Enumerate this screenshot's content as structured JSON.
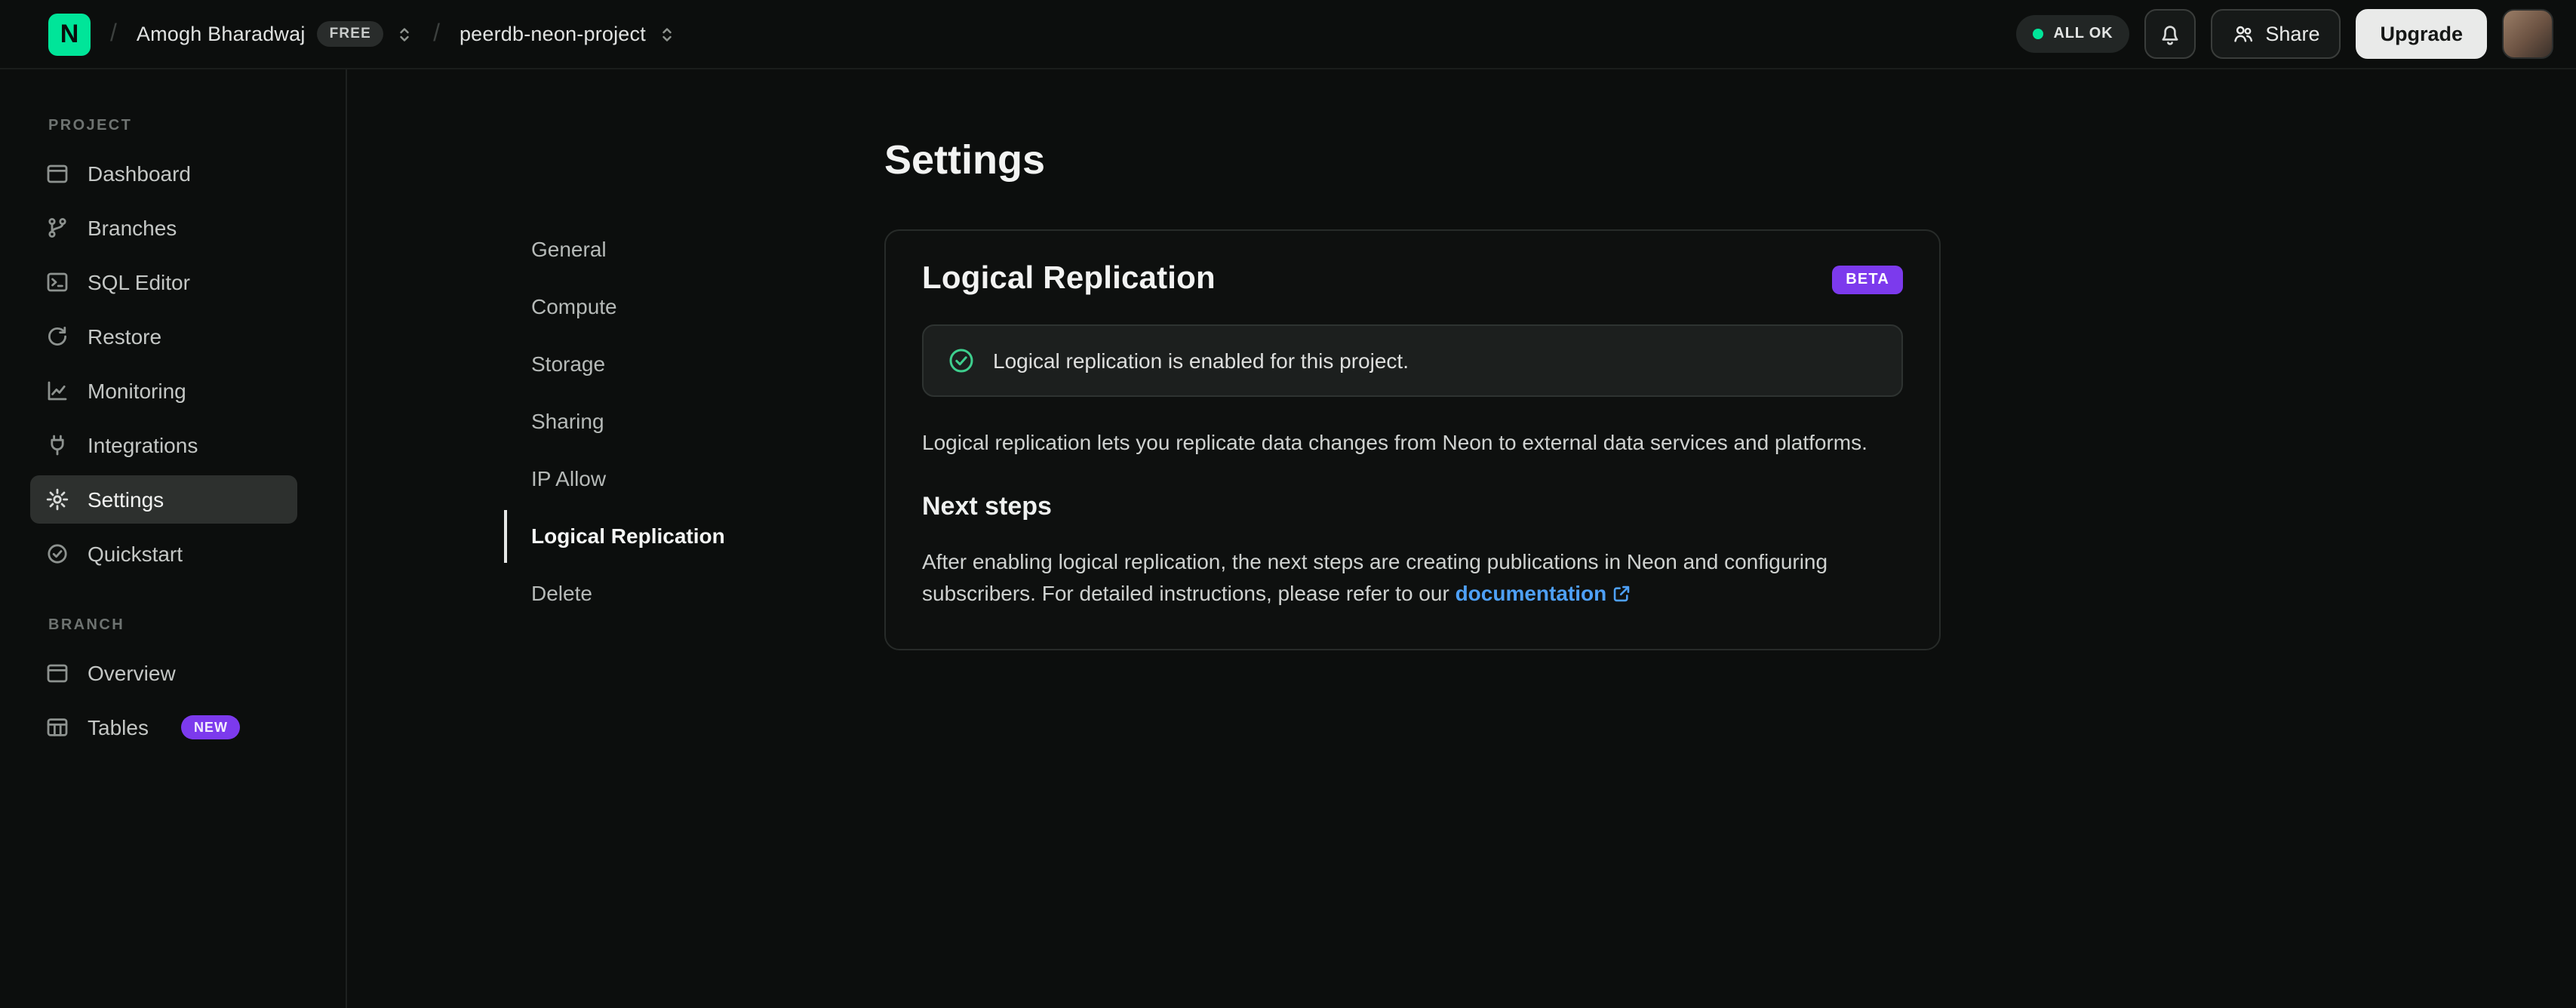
{
  "header": {
    "logo_letter": "N",
    "breadcrumb": {
      "separator": "/",
      "org_name": "Amogh Bharadwaj",
      "org_plan_badge": "FREE",
      "project_name": "peerdb-neon-project"
    },
    "status_label": "ALL OK",
    "share_label": "Share",
    "upgrade_label": "Upgrade"
  },
  "sidebar": {
    "sections": [
      {
        "label": "PROJECT",
        "items": [
          {
            "label": "Dashboard"
          },
          {
            "label": "Branches"
          },
          {
            "label": "SQL Editor"
          },
          {
            "label": "Restore"
          },
          {
            "label": "Monitoring"
          },
          {
            "label": "Integrations"
          },
          {
            "label": "Settings"
          },
          {
            "label": "Quickstart"
          }
        ]
      },
      {
        "label": "BRANCH",
        "items": [
          {
            "label": "Overview"
          },
          {
            "label": "Tables",
            "badge": "NEW"
          }
        ]
      }
    ]
  },
  "settings_nav": {
    "items": [
      "General",
      "Compute",
      "Storage",
      "Sharing",
      "IP Allow",
      "Logical Replication",
      "Delete"
    ],
    "active": "Logical Replication"
  },
  "main": {
    "page_title": "Settings",
    "card": {
      "title": "Logical Replication",
      "badge": "BETA",
      "banner_text": "Logical replication is enabled for this project.",
      "description": "Logical replication lets you replicate data changes from Neon to external data services and platforms.",
      "next_steps_title": "Next steps",
      "next_steps_text": "After enabling logical replication, the next steps are creating publications in Neon and configuring subscribers. For detailed instructions, please refer to our ",
      "doc_link_label": "documentation"
    }
  },
  "colors": {
    "brand_green": "#00e599",
    "badge_purple": "#7c3aed",
    "link_blue": "#4ea0f6",
    "success_green": "#3ecf8e"
  }
}
